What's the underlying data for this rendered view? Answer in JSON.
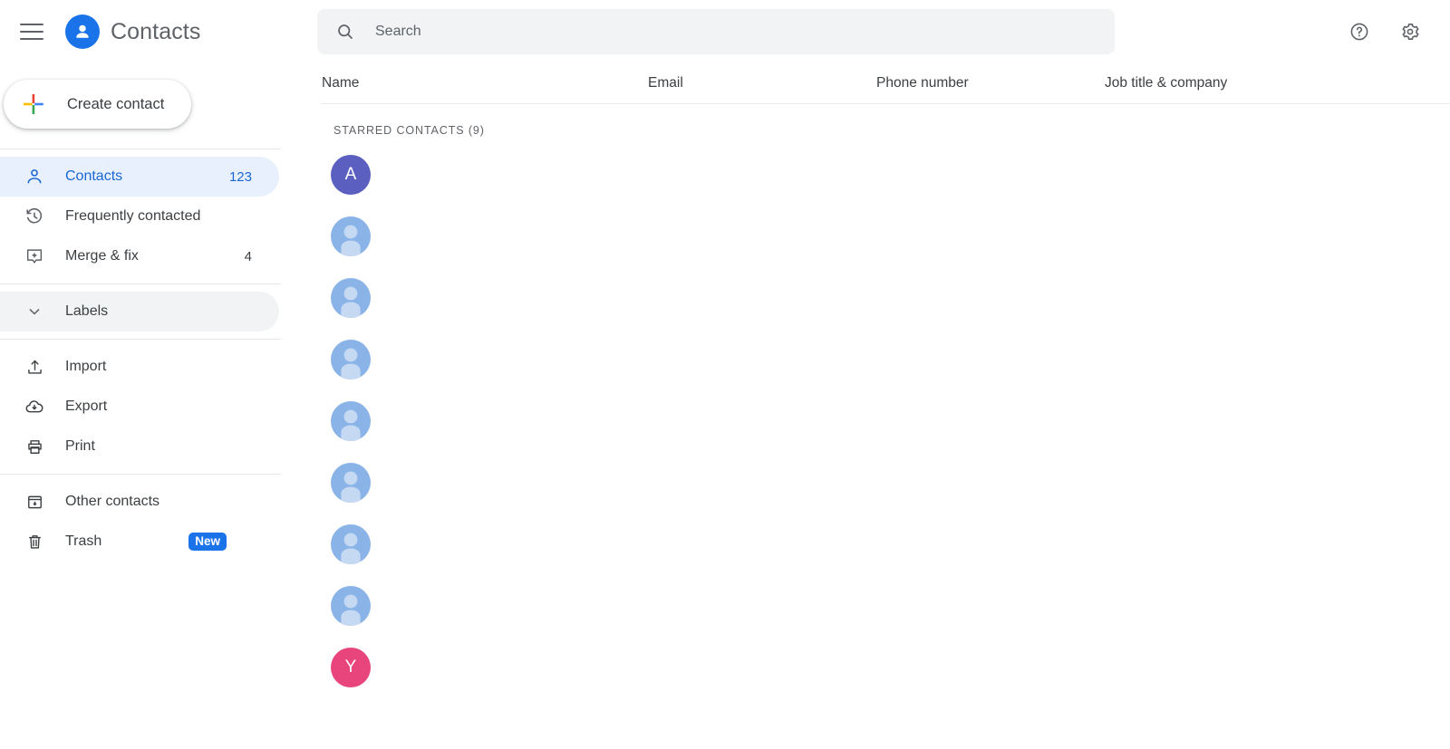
{
  "app": {
    "title": "Contacts",
    "logo_icon": "person-circle-icon",
    "menu_icon": "hamburger-menu-icon"
  },
  "sidebar": {
    "create_button": {
      "label": "Create contact",
      "icon": "google-plus-icon"
    },
    "groups": [
      {
        "items": [
          {
            "label": "Contacts",
            "count": "123",
            "icon": "person-icon",
            "active": true
          },
          {
            "label": "Frequently contacted",
            "count": "",
            "icon": "history-clock-icon",
            "active": false
          },
          {
            "label": "Merge & fix",
            "count": "4",
            "icon": "merge-sparkle-icon",
            "active": false
          }
        ]
      },
      {
        "items": [
          {
            "label": "Labels",
            "count": "",
            "icon": "chevron-down-icon",
            "active": false,
            "style": "labels"
          }
        ]
      },
      {
        "items": [
          {
            "label": "Import",
            "count": "",
            "icon": "upload-icon",
            "active": false
          },
          {
            "label": "Export",
            "count": "",
            "icon": "cloud-download-icon",
            "active": false
          },
          {
            "label": "Print",
            "count": "",
            "icon": "printer-icon",
            "active": false
          }
        ]
      },
      {
        "items": [
          {
            "label": "Other contacts",
            "count": "",
            "icon": "archive-box-icon",
            "active": false
          },
          {
            "label": "Trash",
            "count": "",
            "icon": "trash-icon",
            "active": false,
            "badge": "New"
          }
        ]
      }
    ]
  },
  "search": {
    "placeholder": "Search",
    "value": "",
    "icon": "search-icon"
  },
  "topbar": {
    "help_icon": "help-circle-icon",
    "settings_icon": "gear-icon"
  },
  "table": {
    "columns": [
      {
        "label": "Name"
      },
      {
        "label": "Email"
      },
      {
        "label": "Phone number"
      },
      {
        "label": "Job title & company"
      }
    ],
    "section_label": "STARRED CONTACTS (9)",
    "rows": [
      {
        "avatar_type": "initial",
        "initial": "A",
        "avatar_color": "#5a5fc0",
        "name": "",
        "email": "",
        "phone": "",
        "job": ""
      },
      {
        "avatar_type": "placeholder",
        "initial": "",
        "avatar_color": "#8ab4e8",
        "name": "",
        "email": "",
        "phone": "",
        "job": ""
      },
      {
        "avatar_type": "placeholder",
        "initial": "",
        "avatar_color": "#8ab4e8",
        "name": "",
        "email": "",
        "phone": "",
        "job": ""
      },
      {
        "avatar_type": "placeholder",
        "initial": "",
        "avatar_color": "#8ab4e8",
        "name": "",
        "email": "",
        "phone": "",
        "job": ""
      },
      {
        "avatar_type": "placeholder",
        "initial": "",
        "avatar_color": "#8ab4e8",
        "name": "",
        "email": "",
        "phone": "",
        "job": ""
      },
      {
        "avatar_type": "placeholder",
        "initial": "",
        "avatar_color": "#8ab4e8",
        "name": "",
        "email": "",
        "phone": "",
        "job": ""
      },
      {
        "avatar_type": "placeholder",
        "initial": "",
        "avatar_color": "#8ab4e8",
        "name": "",
        "email": "",
        "phone": "",
        "job": ""
      },
      {
        "avatar_type": "placeholder",
        "initial": "",
        "avatar_color": "#8ab4e8",
        "name": "",
        "email": "",
        "phone": "",
        "job": ""
      },
      {
        "avatar_type": "initial",
        "initial": "Y",
        "avatar_color": "#e8457c",
        "name": "",
        "email": "",
        "phone": "",
        "job": ""
      }
    ]
  },
  "colors": {
    "brand_blue": "#1a73e8",
    "active_pill": "#e8f0fe",
    "active_text": "#1967d2",
    "badge_blue": "#1a73e8",
    "search_bg": "#f1f3f4",
    "text_primary": "#3c4043",
    "text_secondary": "#5f6368"
  }
}
